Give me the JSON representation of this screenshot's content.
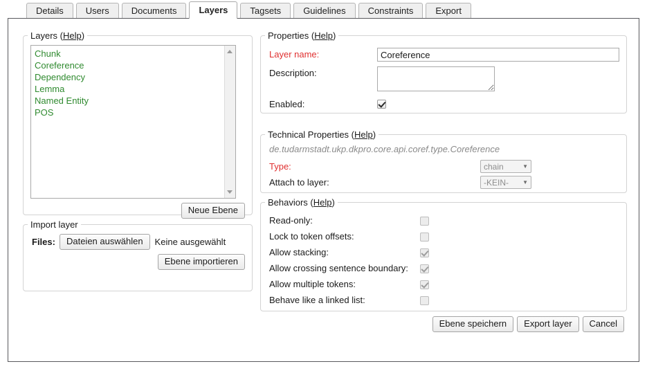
{
  "tabs": [
    {
      "label": "Details",
      "active": false
    },
    {
      "label": "Users",
      "active": false
    },
    {
      "label": "Documents",
      "active": false
    },
    {
      "label": "Layers",
      "active": true
    },
    {
      "label": "Tagsets",
      "active": false
    },
    {
      "label": "Guidelines",
      "active": false
    },
    {
      "label": "Constraints",
      "active": false
    },
    {
      "label": "Export",
      "active": false
    }
  ],
  "layers_panel": {
    "legend": "Layers",
    "help": "Help",
    "items": [
      {
        "label": "Chunk"
      },
      {
        "label": "Coreference"
      },
      {
        "label": "Dependency"
      },
      {
        "label": "Lemma"
      },
      {
        "label": "Named Entity"
      },
      {
        "label": "POS"
      }
    ],
    "new_layer_button": "Neue Ebene",
    "item_color": "#2f8a2f"
  },
  "import_panel": {
    "legend": "Import layer",
    "files_label": "Files:",
    "choose_button": "Dateien auswählen",
    "no_file_text": "Keine ausgewählt",
    "import_button": "Ebene importieren"
  },
  "properties_panel": {
    "legend": "Properties",
    "help": "Help",
    "layer_name_label": "Layer name:",
    "layer_name_value": "Coreference",
    "description_label": "Description:",
    "description_value": "",
    "enabled_label": "Enabled:",
    "enabled_checked": true,
    "required_color": "#e03030"
  },
  "technical_panel": {
    "legend": "Technical Properties",
    "help": "Help",
    "type_name": "de.tudarmstadt.ukp.dkpro.core.api.coref.type.Coreference",
    "type_label": "Type:",
    "type_value": "chain",
    "attach_label": "Attach to layer:",
    "attach_value": "-KEIN-",
    "caret_icon": "▼"
  },
  "behaviors_panel": {
    "legend": "Behaviors",
    "help": "Help",
    "rows": [
      {
        "label": "Read-only:",
        "checked": false
      },
      {
        "label": "Lock to token offsets:",
        "checked": false
      },
      {
        "label": "Allow stacking:",
        "checked": true
      },
      {
        "label": "Allow crossing sentence boundary:",
        "checked": true
      },
      {
        "label": "Allow multiple tokens:",
        "checked": true
      },
      {
        "label": "Behave like a linked list:",
        "checked": false
      }
    ]
  },
  "action_buttons": [
    {
      "label": "Ebene speichern",
      "name": "save-layer-button"
    },
    {
      "label": "Export layer",
      "name": "export-layer-button"
    },
    {
      "label": "Cancel",
      "name": "cancel-button"
    }
  ]
}
